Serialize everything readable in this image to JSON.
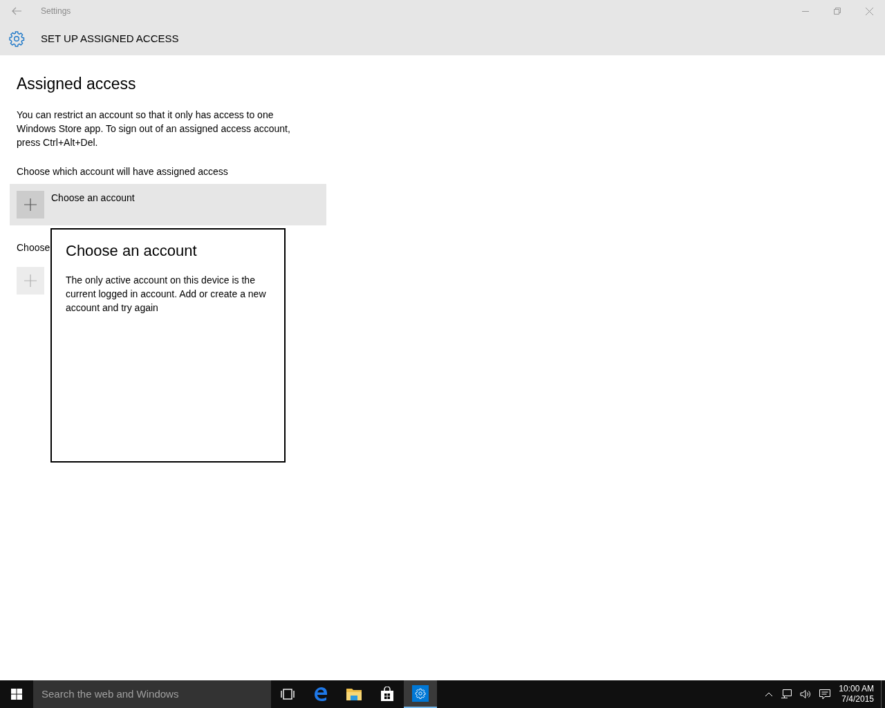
{
  "window": {
    "title": "Settings"
  },
  "header": {
    "title": "SET UP ASSIGNED ACCESS"
  },
  "page": {
    "heading": "Assigned access",
    "description": "You can restrict an account so that it only has access to one Windows Store app. To sign out of an assigned access account, press Ctrl+Alt+Del.",
    "sections": [
      {
        "label": "Choose which account will have assigned access",
        "button_label": "Choose an account",
        "disabled": false,
        "highlighted": true
      },
      {
        "label": "Choose",
        "disabled": true,
        "highlighted": false
      }
    ]
  },
  "flyout": {
    "title": "Choose an account",
    "message": "The only active account on this device is the current logged in account. Add or create a new account and try again"
  },
  "taskbar": {
    "search_placeholder": "Search the web and Windows",
    "apps": [
      {
        "kind": "taskview",
        "selected": false
      },
      {
        "kind": "browser",
        "selected": false
      },
      {
        "kind": "folder",
        "selected": false
      },
      {
        "kind": "store",
        "selected": false
      },
      {
        "kind": "settings",
        "selected": true
      }
    ],
    "time": "10:00 AM",
    "date": "7/4/2015"
  }
}
